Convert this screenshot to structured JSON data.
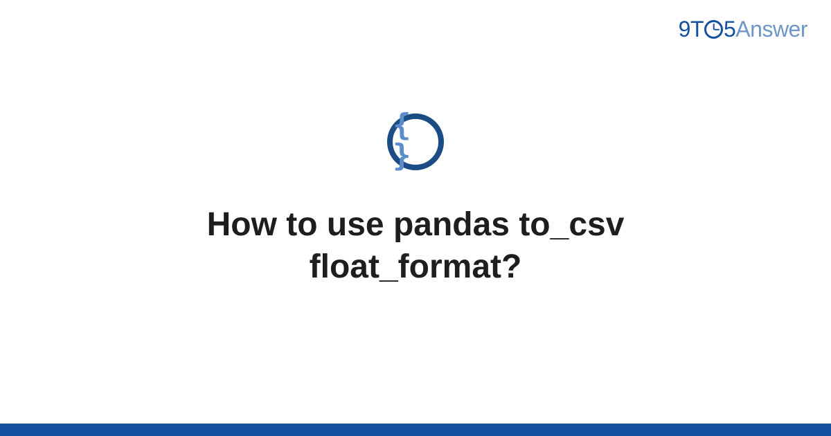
{
  "logo": {
    "nine": "9",
    "to": "T",
    "five": "5",
    "answer": "Answer"
  },
  "icon": {
    "braces": "{ }"
  },
  "title": "How to use pandas to_csv float_format?"
}
